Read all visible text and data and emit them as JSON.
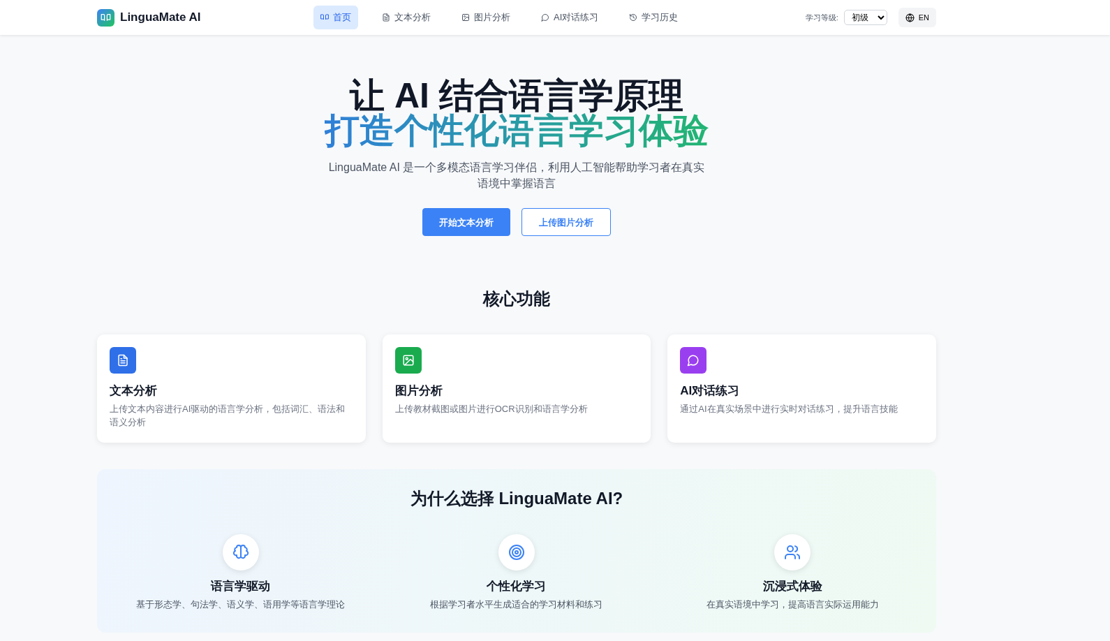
{
  "brand": {
    "name": "LinguaMate AI"
  },
  "nav": [
    {
      "label": "首页",
      "kind": "book",
      "selected": true
    },
    {
      "label": "文本分析",
      "kind": "file",
      "selected": false
    },
    {
      "label": "图片分析",
      "kind": "image",
      "selected": false
    },
    {
      "label": "AI对话练习",
      "kind": "chat",
      "selected": false
    },
    {
      "label": "学习历史",
      "kind": "history",
      "selected": false
    }
  ],
  "level": {
    "label": "学习等级:",
    "value": "初级"
  },
  "language_button": {
    "label": "EN"
  },
  "hero": {
    "title_line_1": "让 AI 结合语言学原理",
    "title_line_2": "打造个性化语言学习体验",
    "subtitle": "LinguaMate AI 是一个多模态语言学习伴侣，利用人工智能帮助学习者在真实语境中掌握语言",
    "buttons": [
      {
        "label": "开始文本分析",
        "kind": "primary"
      },
      {
        "label": "上传图片分析",
        "kind": "outline"
      }
    ]
  },
  "core": {
    "title": "核心功能",
    "cards": [
      {
        "title": "文本分析",
        "text": "上传文本内容进行AI驱动的语言学分析，包括词汇、语法和语义分析",
        "kind": "file",
        "color": "#2f6fe8"
      },
      {
        "title": "图片分析",
        "text": "上传教材截图或图片进行OCR识别和语言学分析",
        "kind": "image",
        "color": "#1aab4f"
      },
      {
        "title": "AI对话练习",
        "text": "通过AI在真实场景中进行实时对话练习，提升语言技能",
        "kind": "chat",
        "color": "#9a3ff0"
      }
    ]
  },
  "why": {
    "title": "为什么选择 LinguaMate AI?",
    "items": [
      {
        "title": "语言学驱动",
        "text": "基于形态学、句法学、语义学、语用学等语言学理论",
        "kind": "brain"
      },
      {
        "title": "个性化学习",
        "text": "根据学习者水平生成适合的学习材料和练习",
        "kind": "target"
      },
      {
        "title": "沉浸式体验",
        "text": "在真实语境中学习，提高语言实际运用能力",
        "kind": "users"
      }
    ]
  }
}
